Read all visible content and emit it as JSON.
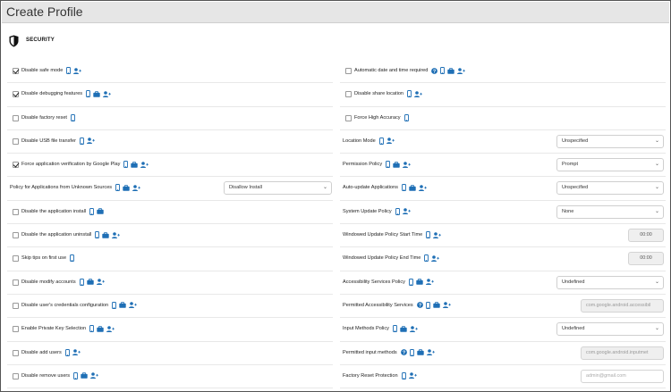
{
  "window": {
    "title": "Create Profile"
  },
  "section": {
    "title": "SECURITY",
    "icon": "shield-icon"
  },
  "colors": {
    "accent": "#1f6fb5",
    "topbar": "#e6e6e6"
  },
  "left": [
    {
      "label": "Disable safe mode",
      "checkbox": true,
      "checked": true,
      "icons": [
        "phone",
        "user"
      ]
    },
    {
      "label": "Disable debugging features",
      "checkbox": true,
      "checked": true,
      "icons": [
        "phone",
        "briefcase",
        "user"
      ]
    },
    {
      "label": "Disable factory reset",
      "checkbox": true,
      "checked": false,
      "icons": [
        "phone"
      ]
    },
    {
      "label": "Disable USB file transfer",
      "checkbox": true,
      "checked": false,
      "icons": [
        "phone",
        "user"
      ]
    },
    {
      "label": "Force application verification by Google Play",
      "checkbox": true,
      "checked": true,
      "icons": [
        "phone",
        "briefcase",
        "user"
      ]
    },
    {
      "label": "Policy for Applications from Unknown Sources",
      "checkbox": false,
      "icons": [
        "phone",
        "briefcase",
        "user"
      ],
      "select": "Disallow Install"
    },
    {
      "label": "Disable the application install",
      "checkbox": true,
      "checked": false,
      "icons": [
        "phone",
        "briefcase"
      ]
    },
    {
      "label": "Disable the application uninstall",
      "checkbox": true,
      "checked": false,
      "icons": [
        "phone",
        "briefcase",
        "user"
      ]
    },
    {
      "label": "Skip tips on first use",
      "checkbox": true,
      "checked": false,
      "icons": [
        "phone"
      ]
    },
    {
      "label": "Disable modify accounts",
      "checkbox": true,
      "checked": false,
      "icons": [
        "phone",
        "briefcase",
        "user"
      ]
    },
    {
      "label": "Disable user's credentials configuration",
      "checkbox": true,
      "checked": false,
      "icons": [
        "phone",
        "briefcase",
        "user"
      ]
    },
    {
      "label": "Enable Private Key Selection",
      "checkbox": true,
      "checked": false,
      "icons": [
        "phone",
        "briefcase",
        "user"
      ]
    },
    {
      "label": "Disable add users",
      "checkbox": true,
      "checked": false,
      "icons": [
        "phone",
        "user"
      ]
    },
    {
      "label": "Disable remove users",
      "checkbox": true,
      "checked": false,
      "icons": [
        "phone",
        "briefcase",
        "user"
      ]
    }
  ],
  "right": [
    {
      "label": "Automatic date and time required",
      "checkbox": true,
      "checked": false,
      "icons": [
        "help",
        "phone",
        "briefcase",
        "user"
      ]
    },
    {
      "label": "Disable share location",
      "checkbox": true,
      "checked": false,
      "icons": [
        "phone",
        "user"
      ]
    },
    {
      "label": "Force High Accuracy",
      "checkbox": true,
      "checked": false,
      "icons": [
        "phone"
      ]
    },
    {
      "label": "Location Mode",
      "checkbox": false,
      "icons": [
        "phone",
        "user"
      ],
      "select": "Unspecified"
    },
    {
      "label": "Permission Policy",
      "checkbox": false,
      "icons": [
        "phone",
        "briefcase",
        "user"
      ],
      "select": "Prompt"
    },
    {
      "label": "Auto-update Applications",
      "checkbox": false,
      "icons": [
        "phone",
        "briefcase",
        "user"
      ],
      "select": "Unspecified"
    },
    {
      "label": "System Update Policy",
      "checkbox": false,
      "icons": [
        "phone",
        "user"
      ],
      "select": "None"
    },
    {
      "label": "Windowed Update Policy Start Time",
      "checkbox": false,
      "icons": [
        "phone",
        "user"
      ],
      "time": "00:00"
    },
    {
      "label": "Windowed Update Policy End Time",
      "checkbox": false,
      "icons": [
        "phone",
        "user"
      ],
      "time": "00:00"
    },
    {
      "label": "Accessibility Services Policy",
      "checkbox": false,
      "icons": [
        "phone",
        "briefcase",
        "user"
      ],
      "select": "Undefined"
    },
    {
      "label": "Permitted Accessibility Services",
      "checkbox": false,
      "icons": [
        "help",
        "phone",
        "briefcase",
        "user"
      ],
      "input_disabled": "com.google.android.accessibil"
    },
    {
      "label": "Input Methods Policy",
      "checkbox": false,
      "icons": [
        "phone",
        "briefcase",
        "user"
      ],
      "select": "Undefined"
    },
    {
      "label": "Permitted input methods",
      "checkbox": false,
      "icons": [
        "help",
        "phone",
        "briefcase",
        "user"
      ],
      "input_disabled": "com.google.android.inputmet"
    },
    {
      "label": "Factory Reset Protection",
      "checkbox": false,
      "icons": [
        "phone",
        "user"
      ],
      "input_placeholder": "admin@gmail.com"
    }
  ]
}
